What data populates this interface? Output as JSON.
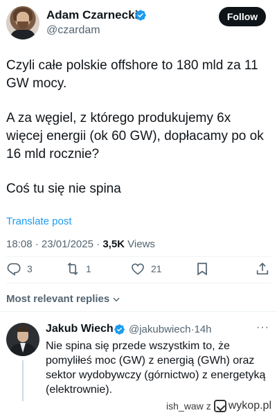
{
  "tweet": {
    "author_name": "Adam Czarnecki",
    "author_handle": "@czardam",
    "follow_label": "Follow",
    "paragraphs": [
      "Czyli całe polskie offshore to 180 mld za 11 GW mocy.",
      "A za węgiel, z którego produkujemy 6x więcej energii (ok 60 GW), dopłacamy po ok 16 mld rocznie?",
      "Coś tu się nie spina"
    ],
    "translate_label": "Translate post",
    "time": "18:08",
    "date": "23/01/2025",
    "views_count": "3,5K",
    "views_label": "Views"
  },
  "actions": {
    "replies": "3",
    "reposts": "1",
    "likes": "21",
    "icons": [
      "reply-icon",
      "repost-icon",
      "like-icon",
      "bookmark-icon",
      "share-icon"
    ]
  },
  "replies_section": {
    "sort_label": "Most relevant replies"
  },
  "reply": {
    "author_name": "Jakub Wiech",
    "author_handle": "@jakubwiech",
    "age": "14h",
    "text": "Nie spina się przede wszystkim to, że pomyliłeś moc (GW) z energią (GWh) oraz sektor wydobywczy (górnictwo) z energetyką (elektrownie)."
  },
  "watermark": {
    "user": "ish_waw",
    "separator": "z",
    "site": "wykop.pl"
  },
  "colors": {
    "accent": "#1d9bf0",
    "text": "#0f1419",
    "muted": "#536471",
    "follow_bg": "#0f1419"
  }
}
